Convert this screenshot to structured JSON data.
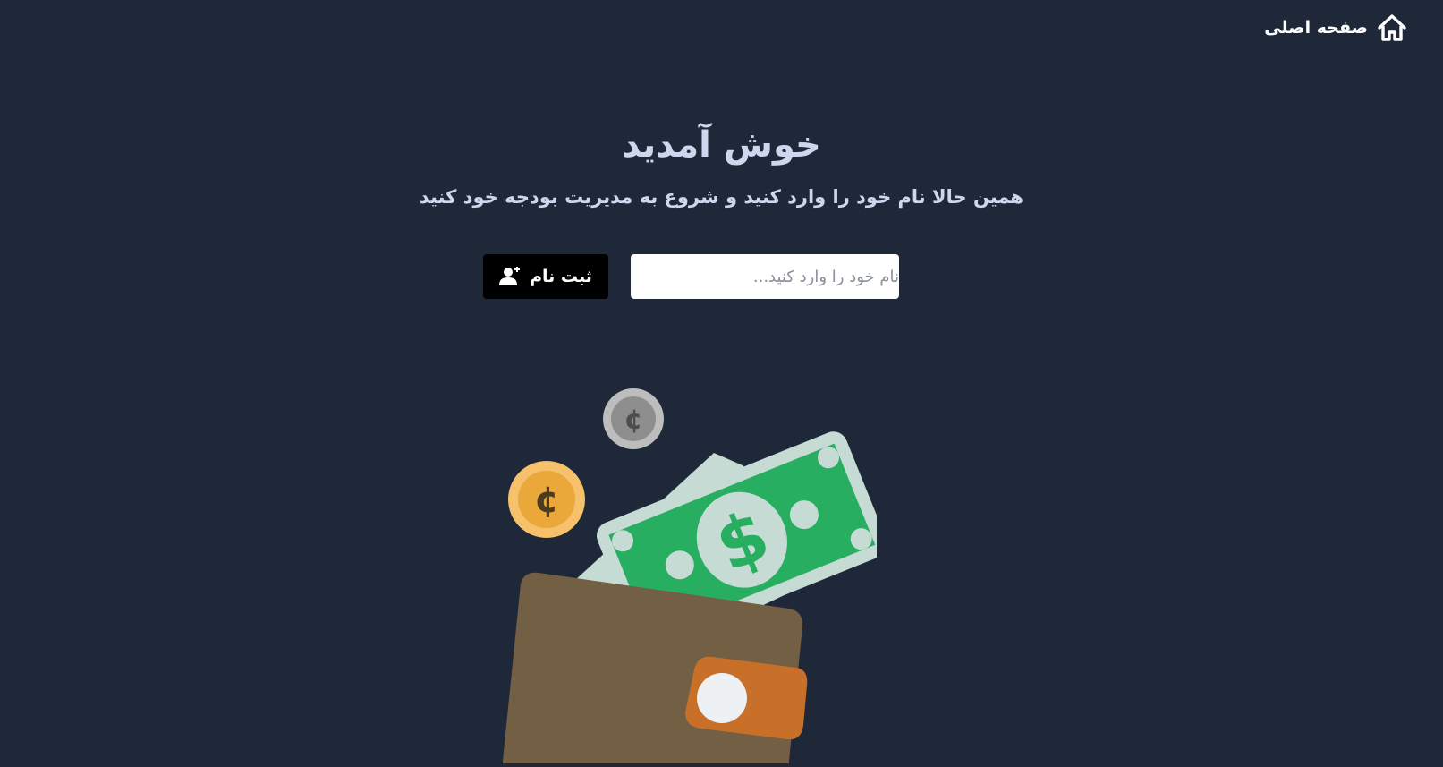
{
  "nav": {
    "home_label": "صفحه اصلی",
    "home_icon": "home-icon"
  },
  "hero": {
    "title": "خوش آمدید",
    "subtitle": "همین حالا نام خود را وارد کنید و شروع به مدیریت بودجه خود کنید"
  },
  "form": {
    "name_input": {
      "value": "",
      "placeholder": "نام خود را وارد کنید..."
    },
    "register_button": {
      "label": "ثبت نام",
      "icon": "user-plus-icon"
    }
  },
  "illustration": {
    "description_icon": "wallet-icon",
    "coin_symbol": "¢"
  },
  "colors": {
    "background": "#1f2839",
    "heading": "#cdd8ee",
    "button_bg": "#000000",
    "money_green": "#27ae60",
    "wallet_brown": "#735f43",
    "wallet_clasp": "#c8702a",
    "coin_gold": "#f0b244",
    "coin_silver": "#a6a6a6"
  }
}
